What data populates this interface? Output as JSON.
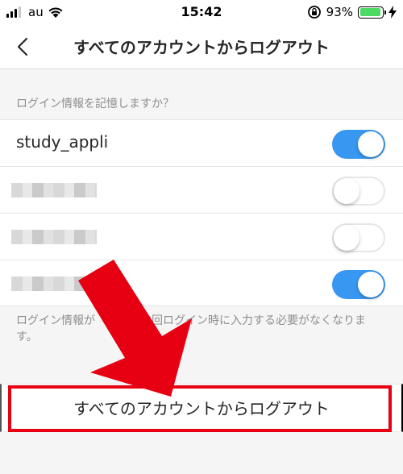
{
  "status_bar": {
    "carrier": "au",
    "time": "15:42",
    "battery_percent": "93%",
    "battery_level": 0.93,
    "battery_color": "#4cd964"
  },
  "nav": {
    "back_icon": "chevron-left-icon",
    "title": "すべてのアカウントからログアウト"
  },
  "section_header": "ログイン情報を記憶しますか？",
  "accounts": [
    {
      "name": "study_appli",
      "remember": true
    },
    {
      "name": "",
      "remember": false
    },
    {
      "name": "",
      "remember": false
    },
    {
      "name": "",
      "remember": true
    }
  ],
  "info_text": "ログイン情報が　　　　次回ログイン時に入力する必要がなくなります。",
  "logout_all_button": "すべてのアカウントからログアウト",
  "colors": {
    "toggle_on": "#3897f0",
    "annotation_red": "#e60012"
  }
}
